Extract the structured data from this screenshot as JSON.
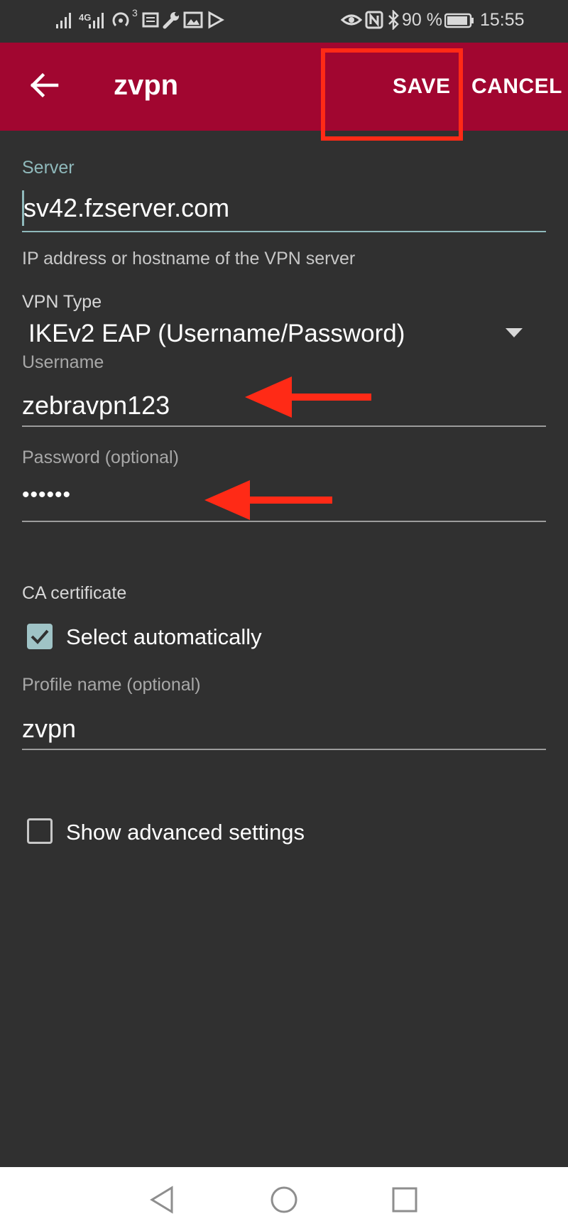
{
  "status_bar": {
    "network_label": "4G",
    "hotspot_count": "3",
    "battery": "90 %",
    "time": "15:55"
  },
  "toolbar": {
    "title": "zvpn",
    "save_label": "SAVE",
    "cancel_label": "CANCEL"
  },
  "form": {
    "server": {
      "label": "Server",
      "value": "sv42.fzserver.com",
      "hint": "IP address or hostname of the VPN server"
    },
    "vpn_type": {
      "label": "VPN Type",
      "value": "IKEv2 EAP (Username/Password)"
    },
    "username": {
      "label": "Username",
      "value": "zebravpn123"
    },
    "password": {
      "label": "Password (optional)",
      "value": "••••••"
    },
    "ca_certificate": {
      "label": "CA certificate",
      "select_automatically_label": "Select automatically",
      "select_automatically_checked": true
    },
    "profile_name": {
      "label": "Profile name (optional)",
      "value": "zvpn"
    },
    "advanced": {
      "label": "Show advanced settings",
      "checked": false
    }
  },
  "colors": {
    "toolbar": "#a10630",
    "background": "#303030",
    "accent": "#8fb9bb",
    "annotation": "#ff2a16"
  }
}
